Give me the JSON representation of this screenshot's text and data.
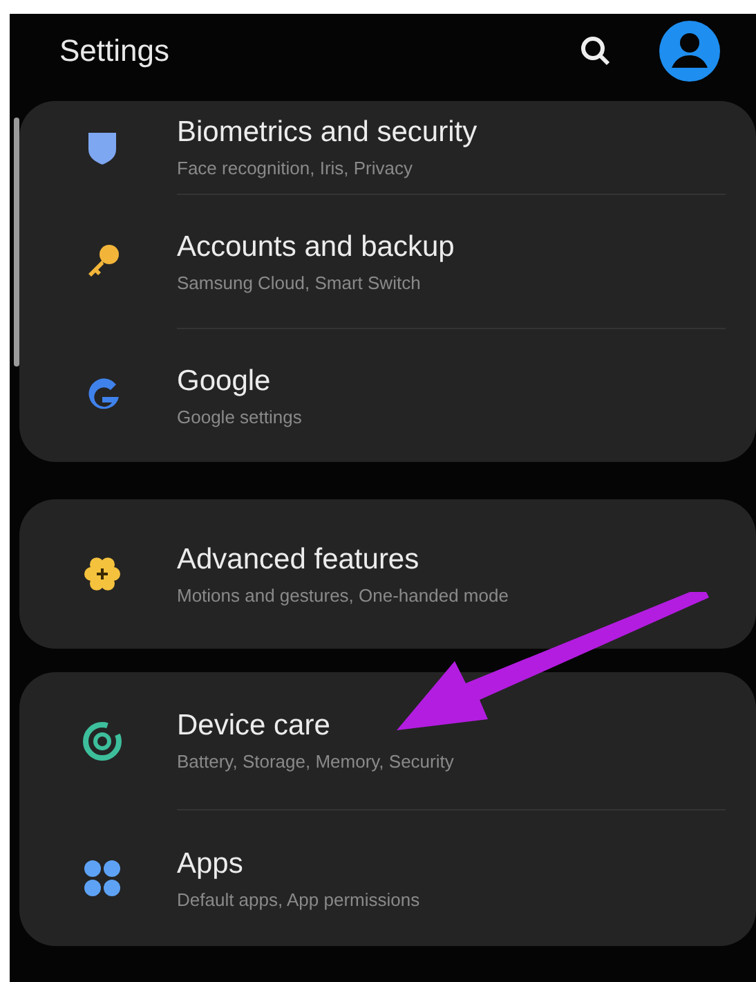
{
  "header": {
    "title": "Settings"
  },
  "groups": [
    {
      "items": [
        {
          "kind": "shield",
          "title": "Biometrics and security",
          "subtitle": "Face recognition, Iris, Privacy"
        },
        {
          "kind": "key",
          "title": "Accounts and backup",
          "subtitle": "Samsung Cloud, Smart Switch"
        },
        {
          "kind": "google",
          "title": "Google",
          "subtitle": "Google settings"
        }
      ]
    },
    {
      "items": [
        {
          "kind": "gear",
          "title": "Advanced features",
          "subtitle": "Motions and gestures, One-handed mode"
        }
      ]
    },
    {
      "items": [
        {
          "kind": "care",
          "title": "Device care",
          "subtitle": "Battery, Storage, Memory, Security"
        },
        {
          "kind": "apps",
          "title": "Apps",
          "subtitle": "Default apps, App permissions"
        }
      ]
    }
  ]
}
